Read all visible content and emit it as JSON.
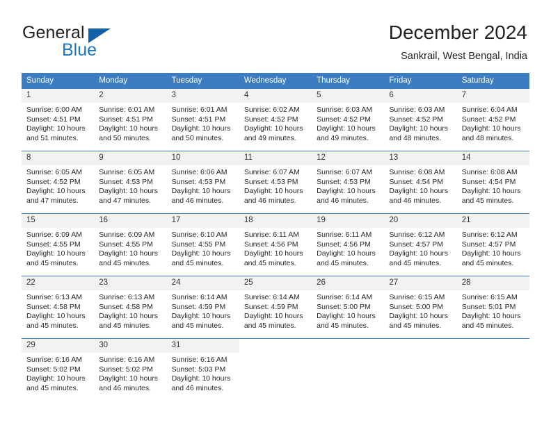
{
  "brand": {
    "name_top": "General",
    "name_bottom": "Blue",
    "accent_color": "#1b75bc",
    "triangle_color": "#1261a8"
  },
  "header": {
    "title": "December 2024",
    "subtitle": "Sankrail, West Bengal, India"
  },
  "calendar": {
    "header_bg": "#3b7dc0",
    "daynum_bg": "#f2f2f2",
    "weekday_headers": [
      "Sunday",
      "Monday",
      "Tuesday",
      "Wednesday",
      "Thursday",
      "Friday",
      "Saturday"
    ],
    "weeks": [
      [
        {
          "day": "1",
          "sunrise": "Sunrise: 6:00 AM",
          "sunset": "Sunset: 4:51 PM",
          "daylight1": "Daylight: 10 hours",
          "daylight2": "and 51 minutes."
        },
        {
          "day": "2",
          "sunrise": "Sunrise: 6:01 AM",
          "sunset": "Sunset: 4:51 PM",
          "daylight1": "Daylight: 10 hours",
          "daylight2": "and 50 minutes."
        },
        {
          "day": "3",
          "sunrise": "Sunrise: 6:01 AM",
          "sunset": "Sunset: 4:51 PM",
          "daylight1": "Daylight: 10 hours",
          "daylight2": "and 50 minutes."
        },
        {
          "day": "4",
          "sunrise": "Sunrise: 6:02 AM",
          "sunset": "Sunset: 4:52 PM",
          "daylight1": "Daylight: 10 hours",
          "daylight2": "and 49 minutes."
        },
        {
          "day": "5",
          "sunrise": "Sunrise: 6:03 AM",
          "sunset": "Sunset: 4:52 PM",
          "daylight1": "Daylight: 10 hours",
          "daylight2": "and 49 minutes."
        },
        {
          "day": "6",
          "sunrise": "Sunrise: 6:03 AM",
          "sunset": "Sunset: 4:52 PM",
          "daylight1": "Daylight: 10 hours",
          "daylight2": "and 48 minutes."
        },
        {
          "day": "7",
          "sunrise": "Sunrise: 6:04 AM",
          "sunset": "Sunset: 4:52 PM",
          "daylight1": "Daylight: 10 hours",
          "daylight2": "and 48 minutes."
        }
      ],
      [
        {
          "day": "8",
          "sunrise": "Sunrise: 6:05 AM",
          "sunset": "Sunset: 4:52 PM",
          "daylight1": "Daylight: 10 hours",
          "daylight2": "and 47 minutes."
        },
        {
          "day": "9",
          "sunrise": "Sunrise: 6:05 AM",
          "sunset": "Sunset: 4:53 PM",
          "daylight1": "Daylight: 10 hours",
          "daylight2": "and 47 minutes."
        },
        {
          "day": "10",
          "sunrise": "Sunrise: 6:06 AM",
          "sunset": "Sunset: 4:53 PM",
          "daylight1": "Daylight: 10 hours",
          "daylight2": "and 46 minutes."
        },
        {
          "day": "11",
          "sunrise": "Sunrise: 6:07 AM",
          "sunset": "Sunset: 4:53 PM",
          "daylight1": "Daylight: 10 hours",
          "daylight2": "and 46 minutes."
        },
        {
          "day": "12",
          "sunrise": "Sunrise: 6:07 AM",
          "sunset": "Sunset: 4:53 PM",
          "daylight1": "Daylight: 10 hours",
          "daylight2": "and 46 minutes."
        },
        {
          "day": "13",
          "sunrise": "Sunrise: 6:08 AM",
          "sunset": "Sunset: 4:54 PM",
          "daylight1": "Daylight: 10 hours",
          "daylight2": "and 46 minutes."
        },
        {
          "day": "14",
          "sunrise": "Sunrise: 6:08 AM",
          "sunset": "Sunset: 4:54 PM",
          "daylight1": "Daylight: 10 hours",
          "daylight2": "and 45 minutes."
        }
      ],
      [
        {
          "day": "15",
          "sunrise": "Sunrise: 6:09 AM",
          "sunset": "Sunset: 4:55 PM",
          "daylight1": "Daylight: 10 hours",
          "daylight2": "and 45 minutes."
        },
        {
          "day": "16",
          "sunrise": "Sunrise: 6:09 AM",
          "sunset": "Sunset: 4:55 PM",
          "daylight1": "Daylight: 10 hours",
          "daylight2": "and 45 minutes."
        },
        {
          "day": "17",
          "sunrise": "Sunrise: 6:10 AM",
          "sunset": "Sunset: 4:55 PM",
          "daylight1": "Daylight: 10 hours",
          "daylight2": "and 45 minutes."
        },
        {
          "day": "18",
          "sunrise": "Sunrise: 6:11 AM",
          "sunset": "Sunset: 4:56 PM",
          "daylight1": "Daylight: 10 hours",
          "daylight2": "and 45 minutes."
        },
        {
          "day": "19",
          "sunrise": "Sunrise: 6:11 AM",
          "sunset": "Sunset: 4:56 PM",
          "daylight1": "Daylight: 10 hours",
          "daylight2": "and 45 minutes."
        },
        {
          "day": "20",
          "sunrise": "Sunrise: 6:12 AM",
          "sunset": "Sunset: 4:57 PM",
          "daylight1": "Daylight: 10 hours",
          "daylight2": "and 45 minutes."
        },
        {
          "day": "21",
          "sunrise": "Sunrise: 6:12 AM",
          "sunset": "Sunset: 4:57 PM",
          "daylight1": "Daylight: 10 hours",
          "daylight2": "and 45 minutes."
        }
      ],
      [
        {
          "day": "22",
          "sunrise": "Sunrise: 6:13 AM",
          "sunset": "Sunset: 4:58 PM",
          "daylight1": "Daylight: 10 hours",
          "daylight2": "and 45 minutes."
        },
        {
          "day": "23",
          "sunrise": "Sunrise: 6:13 AM",
          "sunset": "Sunset: 4:58 PM",
          "daylight1": "Daylight: 10 hours",
          "daylight2": "and 45 minutes."
        },
        {
          "day": "24",
          "sunrise": "Sunrise: 6:14 AM",
          "sunset": "Sunset: 4:59 PM",
          "daylight1": "Daylight: 10 hours",
          "daylight2": "and 45 minutes."
        },
        {
          "day": "25",
          "sunrise": "Sunrise: 6:14 AM",
          "sunset": "Sunset: 4:59 PM",
          "daylight1": "Daylight: 10 hours",
          "daylight2": "and 45 minutes."
        },
        {
          "day": "26",
          "sunrise": "Sunrise: 6:14 AM",
          "sunset": "Sunset: 5:00 PM",
          "daylight1": "Daylight: 10 hours",
          "daylight2": "and 45 minutes."
        },
        {
          "day": "27",
          "sunrise": "Sunrise: 6:15 AM",
          "sunset": "Sunset: 5:00 PM",
          "daylight1": "Daylight: 10 hours",
          "daylight2": "and 45 minutes."
        },
        {
          "day": "28",
          "sunrise": "Sunrise: 6:15 AM",
          "sunset": "Sunset: 5:01 PM",
          "daylight1": "Daylight: 10 hours",
          "daylight2": "and 45 minutes."
        }
      ],
      [
        {
          "day": "29",
          "sunrise": "Sunrise: 6:16 AM",
          "sunset": "Sunset: 5:02 PM",
          "daylight1": "Daylight: 10 hours",
          "daylight2": "and 45 minutes."
        },
        {
          "day": "30",
          "sunrise": "Sunrise: 6:16 AM",
          "sunset": "Sunset: 5:02 PM",
          "daylight1": "Daylight: 10 hours",
          "daylight2": "and 46 minutes."
        },
        {
          "day": "31",
          "sunrise": "Sunrise: 6:16 AM",
          "sunset": "Sunset: 5:03 PM",
          "daylight1": "Daylight: 10 hours",
          "daylight2": "and 46 minutes."
        },
        {
          "day": "",
          "sunrise": "",
          "sunset": "",
          "daylight1": "",
          "daylight2": ""
        },
        {
          "day": "",
          "sunrise": "",
          "sunset": "",
          "daylight1": "",
          "daylight2": ""
        },
        {
          "day": "",
          "sunrise": "",
          "sunset": "",
          "daylight1": "",
          "daylight2": ""
        },
        {
          "day": "",
          "sunrise": "",
          "sunset": "",
          "daylight1": "",
          "daylight2": ""
        }
      ]
    ]
  }
}
